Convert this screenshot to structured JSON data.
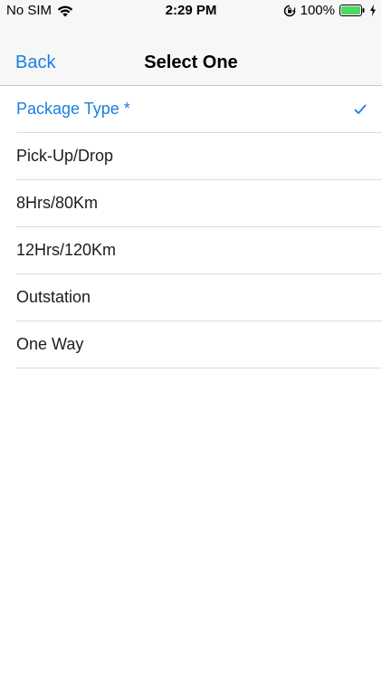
{
  "status_bar": {
    "carrier": "No SIM",
    "time": "2:29 PM",
    "battery_percent": "100%",
    "battery_level": 1.0,
    "icons": [
      "wifi-icon",
      "rotation-lock-icon",
      "battery-icon",
      "charging-bolt-icon"
    ]
  },
  "nav": {
    "back_label": "Back",
    "title": "Select One"
  },
  "options": [
    {
      "label": "Package Type *",
      "selected": true
    },
    {
      "label": "Pick-Up/Drop",
      "selected": false
    },
    {
      "label": "8Hrs/80Km",
      "selected": false
    },
    {
      "label": "12Hrs/120Km",
      "selected": false
    },
    {
      "label": "Outstation",
      "selected": false
    },
    {
      "label": "One Way",
      "selected": false
    }
  ],
  "colors": {
    "accent": "#1a7fe0",
    "battery_green": "#4cd964",
    "separator": "#dcdcdc",
    "nav_background": "#f7f7f7"
  }
}
